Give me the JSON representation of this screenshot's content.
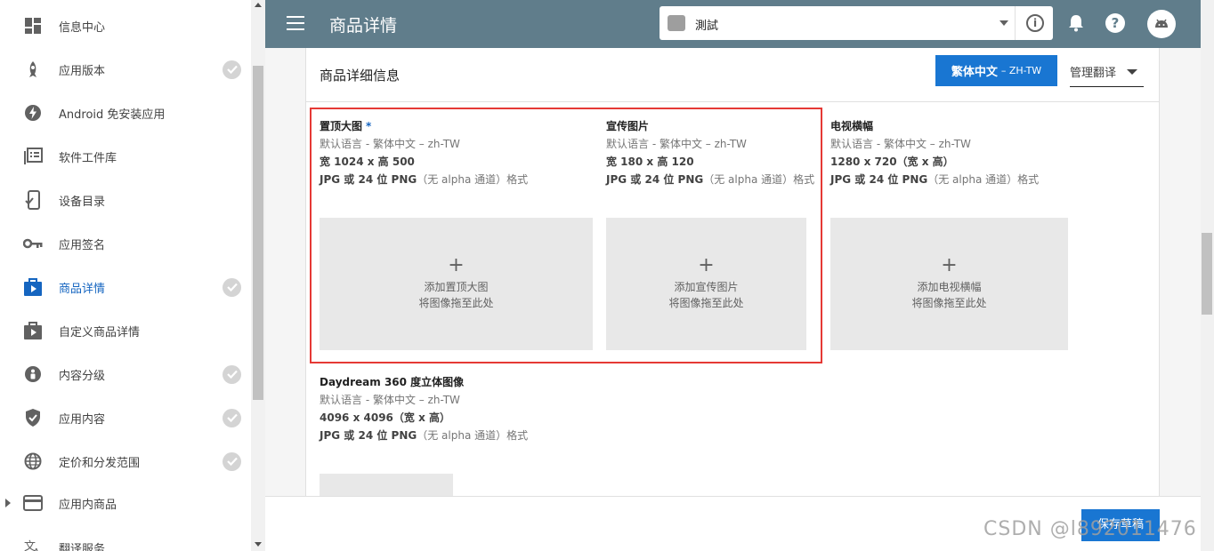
{
  "sidebar": {
    "items": [
      {
        "label": "信息中心",
        "icon": "dashboard-icon",
        "checked": false,
        "active": false
      },
      {
        "label": "应用版本",
        "icon": "rocket-icon",
        "checked": true,
        "active": false
      },
      {
        "label": "Android 免安装应用",
        "icon": "instant-app-icon",
        "checked": false,
        "active": false
      },
      {
        "label": "软件工件库",
        "icon": "library-icon",
        "checked": false,
        "active": false
      },
      {
        "label": "设备目录",
        "icon": "device-catalog-icon",
        "checked": false,
        "active": false
      },
      {
        "label": "应用签名",
        "icon": "key-icon",
        "checked": false,
        "active": false
      },
      {
        "label": "商品详情",
        "icon": "store-listing-icon",
        "checked": true,
        "active": true
      },
      {
        "label": "自定义商品详情",
        "icon": "custom-listing-icon",
        "checked": false,
        "active": false
      },
      {
        "label": "内容分级",
        "icon": "content-rating-icon",
        "checked": true,
        "active": false
      },
      {
        "label": "应用内容",
        "icon": "shield-icon",
        "checked": true,
        "active": false
      },
      {
        "label": "定价和分发范围",
        "icon": "globe-icon",
        "checked": true,
        "active": false
      },
      {
        "label": "应用内商品",
        "icon": "credit-card-icon",
        "checked": false,
        "active": false,
        "expandable": true
      },
      {
        "label": "翻译服务",
        "icon": "translate-icon",
        "checked": false,
        "active": false
      }
    ]
  },
  "header": {
    "title": "商品详情",
    "app_name": "測試",
    "header_color": "#607d8b"
  },
  "card": {
    "title": "商品详细信息",
    "lang_button": {
      "label": "繁体中文",
      "code": "– ZH-TW"
    },
    "manage_translate": "管理翻译"
  },
  "assets": {
    "feature": {
      "title": "置顶大图",
      "required_mark": "*",
      "lang": "默认语言 - 繁体中文 – zh-TW",
      "size": "宽 1024 x 高 500",
      "format_bold": "JPG 或 24 位 PNG",
      "format_rest": "（无 alpha 通道）格式",
      "add_label": "添加置顶大图",
      "drag_label": "将图像拖至此处"
    },
    "promo": {
      "title": "宣传图片",
      "lang": "默认语言 - 繁体中文 – zh-TW",
      "size": "宽 180 x 高 120",
      "format_bold": "JPG 或 24 位 PNG",
      "format_rest": "（无 alpha 通道）格式",
      "add_label": "添加宣传图片",
      "drag_label": "将图像拖至此处"
    },
    "tv": {
      "title": "电视横幅",
      "lang": "默认语言 - 繁体中文 – zh-TW",
      "size": "1280 x 720（宽 x 高）",
      "format_bold": "JPG 或 24 位 PNG",
      "format_rest": "（无 alpha 通道）格式",
      "add_label": "添加电视横幅",
      "drag_label": "将图像拖至此处"
    },
    "daydream": {
      "title": "Daydream 360 度立体图像",
      "lang": "默认语言 - 繁体中文 – zh-TW",
      "size": "4096 x 4096（宽 x 高）",
      "format_bold": "JPG 或 24 位 PNG",
      "format_rest": "（无 alpha 通道）格式"
    }
  },
  "footer": {
    "save_label": "保存草稿"
  },
  "watermark": "CSDN @l892011476",
  "colors": {
    "accent": "#1976d2",
    "highlight": "#e53935",
    "active_nav": "#1565c0"
  }
}
